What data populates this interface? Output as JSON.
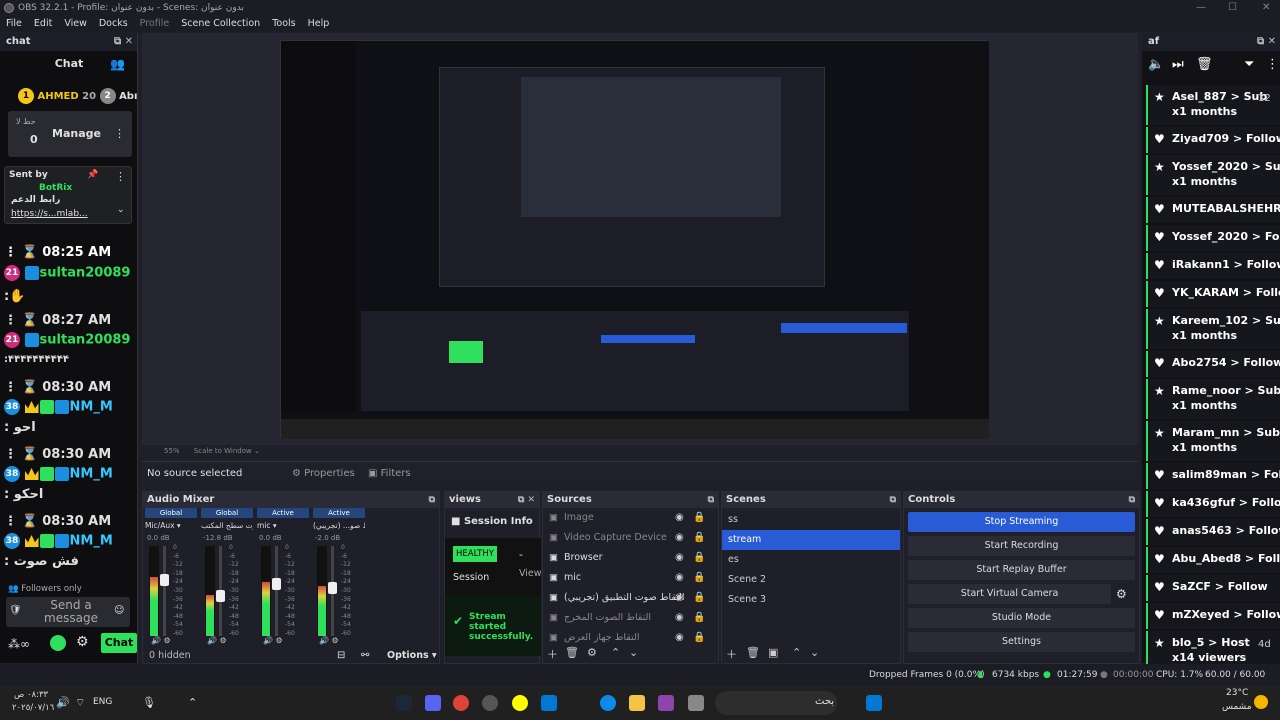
{
  "window": {
    "title": "OBS 32.2.1 - Profile: بدون عنوان - Scenes: بدون عنوان"
  },
  "menu": [
    "File",
    "Edit",
    "View",
    "Docks",
    "Profile",
    "Scene Collection",
    "Tools",
    "Help"
  ],
  "chat_dock": {
    "title": "chat",
    "header": "Chat",
    "top_users": [
      {
        "rank": "1",
        "name": "AHMED",
        "count": "20"
      },
      {
        "rank": "2",
        "name": "Abı"
      }
    ],
    "manage": {
      "label": "Manage",
      "small": "حط لا",
      "count": "0"
    },
    "pinned": {
      "sent_by": "Sent by",
      "bot": "BotRix",
      "text": "رابط الدعم",
      "link": "https://s...mlab..."
    },
    "messages": [
      {
        "time": "08:25 AM",
        "badge": "21",
        "user": "sultan20089",
        "body": ":✋"
      },
      {
        "time": "08:27 AM",
        "badge": "21",
        "user": "sultan20089",
        "body": ":۴۴۴۴۴۴۴۴۴۴"
      },
      {
        "time": "08:30 AM",
        "badge": "38",
        "user": "NM_M",
        "body": ": احو"
      },
      {
        "time": "08:30 AM",
        "badge": "38",
        "user": "NM_M",
        "body": ": احكو"
      },
      {
        "time": "08:30 AM",
        "badge": "38",
        "user": "NM_M",
        "body": ": فش صوت"
      }
    ],
    "followers_only": "Followers only",
    "placeholder": "Send a message",
    "chat_button": "Chat"
  },
  "preview": {
    "zoom": "55%",
    "scale": "Scale to Window"
  },
  "source_toolbar": {
    "no_source": "No source selected",
    "properties": "Properties",
    "filters": "Filters"
  },
  "audio_mixer": {
    "title": "Audio Mixer",
    "channels": [
      {
        "tag": "Global",
        "name": "Mic/Aux",
        "db": "0.0 dB",
        "level": 0.65
      },
      {
        "tag": "Global",
        "name": "صوت سطح المكتب",
        "db": "-12.8 dB",
        "level": 0.45
      },
      {
        "tag": "Active",
        "name": "mic",
        "db": "0.0 dB",
        "level": 0.6
      },
      {
        "tag": "Active",
        "name": "التقاط صو... (تجريبي)",
        "db": "-2.0 dB",
        "level": 0.55
      }
    ],
    "scale": [
      "0",
      "-6",
      "-12",
      "-18",
      "-24",
      "-30",
      "-36",
      "-42",
      "-48",
      "-54",
      "-60"
    ],
    "hidden": "0 hidden",
    "options": "Options"
  },
  "views": {
    "title": "views",
    "session_info": "Session Info",
    "healthy": "HEALTHY",
    "session": "Session",
    "view": "View",
    "dash": "-",
    "stream_msg": "Stream started successfully."
  },
  "sources": {
    "title": "Sources",
    "items": [
      {
        "name": "Image",
        "dim": true
      },
      {
        "name": "Video Capture Device",
        "dim": true
      },
      {
        "name": "Browser",
        "dim": false
      },
      {
        "name": "mic",
        "dim": false
      },
      {
        "name": "التقاط صوت التطبيق (تجريبي)",
        "dim": false
      },
      {
        "name": "التقاط الصوت المخرج",
        "dim": true
      },
      {
        "name": "التقاط جهاز العرض",
        "dim": true
      }
    ]
  },
  "scenes": {
    "title": "Scenes",
    "items": [
      "ss",
      "stream",
      "es",
      "Scene 2",
      "Scene 3"
    ],
    "selected": 1
  },
  "controls": {
    "title": "Controls",
    "buttons": [
      "Stop Streaming",
      "Start Recording",
      "Start Replay Buffer",
      "Start Virtual Camera",
      "Studio Mode",
      "Settings"
    ]
  },
  "alerts_dock": {
    "title": "af",
    "items": [
      {
        "icon": "star",
        "text": "Asel_887 > Sub",
        "sub": "x1 months",
        "extra": "12"
      },
      {
        "icon": "heart",
        "text": "Ziyad709 > Follow"
      },
      {
        "icon": "star",
        "text": "Yossef_2020 > Sub",
        "sub": "x1 months"
      },
      {
        "icon": "heart",
        "text": "MUTEABALSHEHRI"
      },
      {
        "icon": "heart",
        "text": "Yossef_2020 > Follo"
      },
      {
        "icon": "heart",
        "text": "iRakann1 > Follow"
      },
      {
        "icon": "heart",
        "text": "YK_KARAM > Follo"
      },
      {
        "icon": "star",
        "text": "Kareem_102 > Sub",
        "sub": "x1 months"
      },
      {
        "icon": "heart",
        "text": "Abo2754 > Follow"
      },
      {
        "icon": "star",
        "text": "Rame_noor > Sub",
        "sub": "x1 months"
      },
      {
        "icon": "star",
        "text": "Maram_mn > Sub",
        "sub": "x1 months"
      },
      {
        "icon": "heart",
        "text": "salim89man > Follo"
      },
      {
        "icon": "heart",
        "text": "ka436gfuf > Follow"
      },
      {
        "icon": "heart",
        "text": "anas5463 > Follow"
      },
      {
        "icon": "heart",
        "text": "Abu_Abed8 > Follo"
      },
      {
        "icon": "heart",
        "text": "SaZCF > Follow"
      },
      {
        "icon": "heart",
        "text": "mZXeyed > Follow"
      },
      {
        "icon": "star",
        "text": "blo_5 > Host",
        "sub": "x14 viewers",
        "extra": "4d"
      }
    ]
  },
  "status": {
    "dropped": "Dropped Frames 0 (0.0%)",
    "kbps": "6734 kbps",
    "stream_time": "01:27:59",
    "rec_time": "00:00:00",
    "cpu": "CPU: 1.7%",
    "fps": "60.00 / 60.00 FPS"
  },
  "taskbar": {
    "time": "٠٨:٣٣ ص",
    "date": "٢٠٢٥/٠٧/١٦",
    "lang": "ENG",
    "search": "بحث",
    "temp": "23°C",
    "weather": "مشمس"
  },
  "colors": {
    "accent": "#2a5bd7",
    "green": "#2ee05b",
    "cyan": "#35c8ff"
  }
}
